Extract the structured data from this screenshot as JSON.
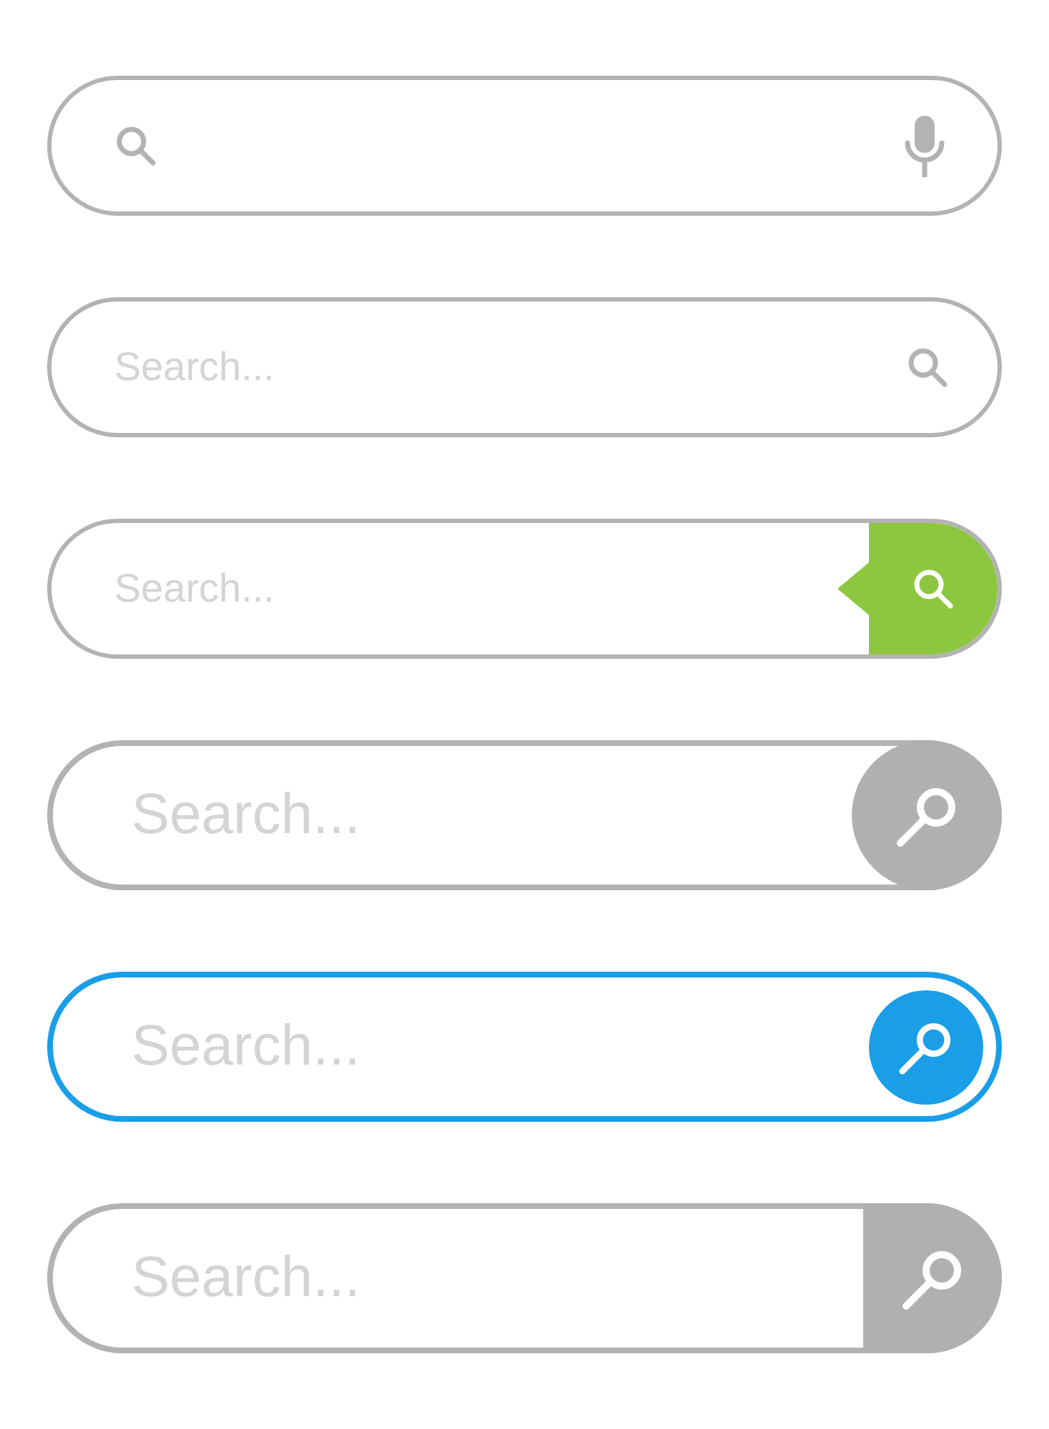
{
  "search_bars": [
    {
      "kind": "mic",
      "color": "#b3b3b3"
    },
    {
      "kind": "icon",
      "color": "#b3b3b3",
      "placeholder": "Search..."
    },
    {
      "kind": "tag",
      "color": "#8dc63f",
      "placeholder": "Search..."
    },
    {
      "kind": "circle",
      "color": "#b0b0b0",
      "placeholder": "Search..."
    },
    {
      "kind": "ring",
      "color": "#1a9ee8",
      "placeholder": "Search..."
    },
    {
      "kind": "block",
      "color": "#b0b0b0",
      "placeholder": "Search..."
    }
  ]
}
